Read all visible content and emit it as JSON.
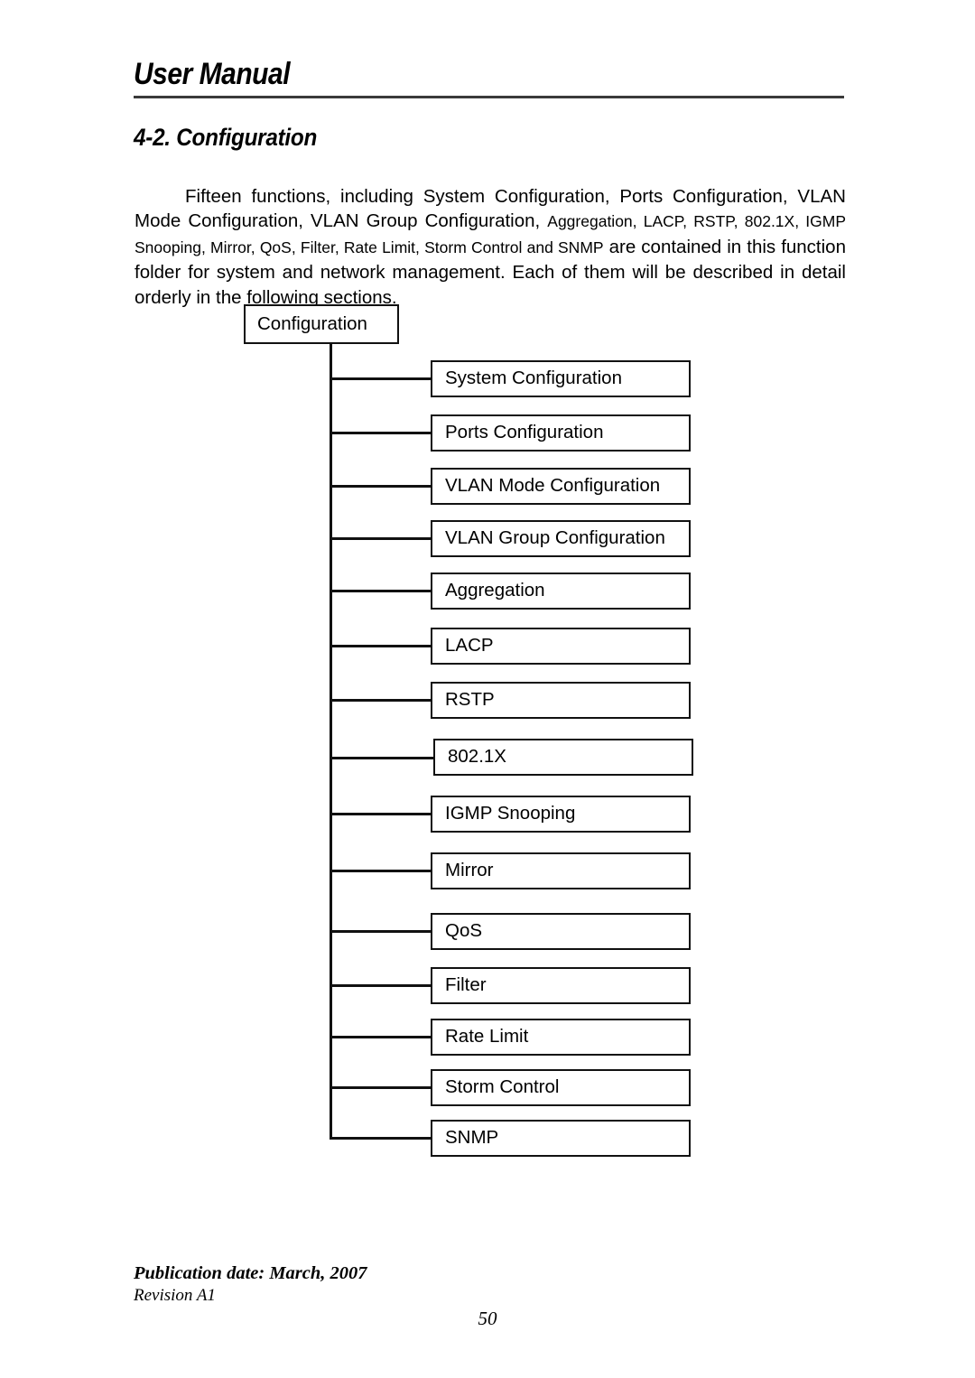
{
  "header": {
    "title": "User Manual"
  },
  "section": {
    "heading": "4-2. Configuration"
  },
  "paragraph": {
    "part1": "Fifteen functions, including System Configuration, Ports Configuration, VLAN Mode Configuration, VLAN Group Configuration, ",
    "part2_small": "Aggregation, LACP, RSTP, 802.1X, IGMP Snooping, Mirror, QoS, Filter, Rate Limit, Storm Control and SNMP",
    "part3": " are contained in this function folder for system and network management. Each of them will be described in detail orderly in the following sections."
  },
  "diagram": {
    "type": "tree",
    "root": "Configuration",
    "children": [
      "System Configuration",
      "Ports Configuration",
      "VLAN Mode Configuration",
      "VLAN Group Configuration",
      "Aggregation",
      "LACP",
      "RSTP",
      "802.1X",
      "IGMP Snooping",
      "Mirror",
      "QoS",
      "Filter",
      "Rate Limit",
      "Storm Control",
      "SNMP"
    ]
  },
  "footer": {
    "publication_date": "Publication date: March, 2007",
    "revision": "Revision A1",
    "page_number": "50"
  },
  "colors": {
    "ink": "#000000",
    "rule": "#3a3a3a",
    "paper": "#ffffff"
  }
}
